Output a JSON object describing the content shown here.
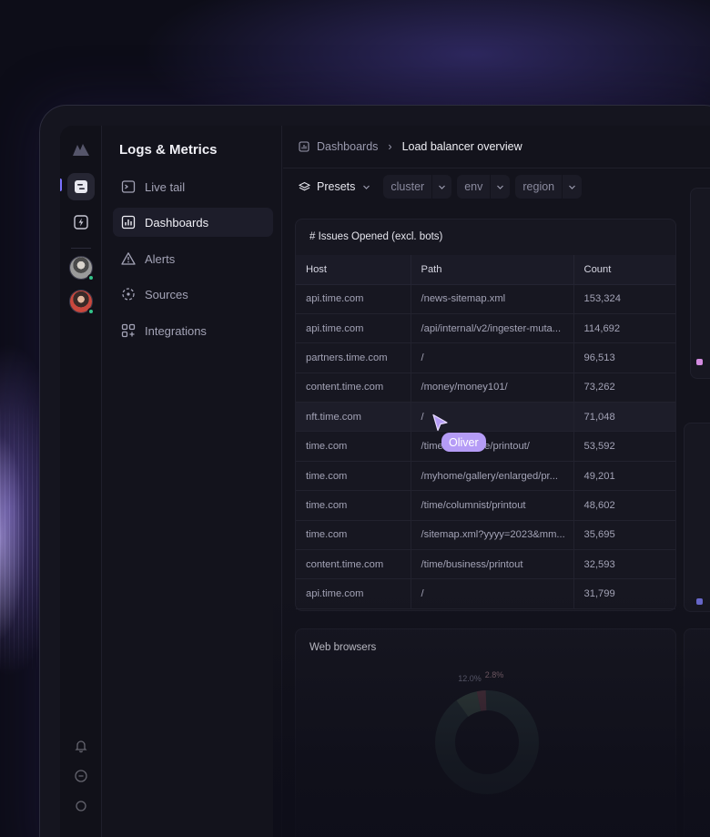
{
  "app": {
    "title": "Logs & Metrics"
  },
  "sidebar": {
    "items": [
      {
        "label": "Live tail",
        "icon": "terminal-icon"
      },
      {
        "label": "Dashboards",
        "icon": "bar-chart-icon",
        "active": true
      },
      {
        "label": "Alerts",
        "icon": "alert-triangle-icon"
      },
      {
        "label": "Sources",
        "icon": "sources-icon"
      },
      {
        "label": "Integrations",
        "icon": "integrations-icon"
      }
    ]
  },
  "breadcrumb": {
    "parent": "Dashboards",
    "separator": "›",
    "current": "Load balancer overview"
  },
  "filters": {
    "presets_label": "Presets",
    "chips": [
      "cluster",
      "env",
      "region"
    ]
  },
  "issues_table": {
    "title": "# Issues Opened (excl. bots)",
    "columns": [
      "Host",
      "Path",
      "Count"
    ],
    "rows": [
      [
        "api.time.com",
        "/news-sitemap.xml",
        "153,324"
      ],
      [
        "api.time.com",
        "/api/internal/v2/ingester-muta...",
        "114,692"
      ],
      [
        "partners.time.com",
        "/",
        "96,513"
      ],
      [
        "content.time.com",
        "/money/money101/",
        "73,262"
      ],
      [
        "nft.time.com",
        "/",
        "71,048"
      ],
      [
        "time.com",
        "/time/magazine/printout/",
        "53,592"
      ],
      [
        "time.com",
        "/myhome/gallery/enlarged/pr...",
        "49,201"
      ],
      [
        "time.com",
        "/time/columnist/printout",
        "48,602"
      ],
      [
        "time.com",
        "/sitemap.xml?yyyy=2023&mm...",
        "35,695"
      ],
      [
        "content.time.com",
        "/time/business/printout",
        "32,593"
      ],
      [
        "api.time.com",
        "/",
        "31,799"
      ]
    ],
    "highlighted_row": 4
  },
  "browsers_card": {
    "title": "Web browsers",
    "labels": [
      "12.0%",
      "2.8%"
    ]
  },
  "cursor": {
    "name": "Oliver",
    "color": "#b59cf6"
  },
  "colors": {
    "background": "#0d0d18",
    "accent": "#7b72ff",
    "online": "#33c48a"
  }
}
